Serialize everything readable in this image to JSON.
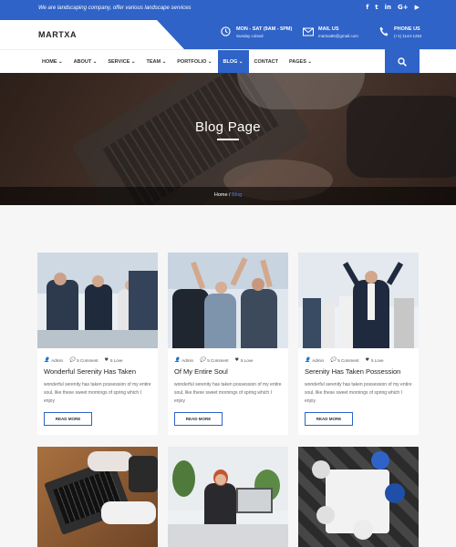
{
  "topbar": {
    "tagline": "We are landscaping company, offer various landscape services",
    "social": [
      {
        "icon": "facebook-icon",
        "glyph": "f"
      },
      {
        "icon": "twitter-icon",
        "glyph": "t"
      },
      {
        "icon": "linkedin-icon",
        "glyph": "in"
      },
      {
        "icon": "google-plus-icon",
        "glyph": "G+"
      },
      {
        "icon": "youtube-icon",
        "glyph": "▶"
      }
    ]
  },
  "header": {
    "logo": "MARTXA",
    "hours": {
      "title": "MON - SAT (9AM - 5PM)",
      "sub": "Sunday colsed"
    },
    "mail": {
      "title": "MAIL US",
      "sub": "martxa85@gmail.com"
    },
    "phone": {
      "title": "PHONE US",
      "sub": "(+1) 1144-1254"
    }
  },
  "nav": {
    "items": [
      {
        "label": "HOME",
        "caret": true
      },
      {
        "label": "ABOUT",
        "caret": true
      },
      {
        "label": "SERVICE",
        "caret": true
      },
      {
        "label": "TEAM",
        "caret": true
      },
      {
        "label": "PORTFOLIO",
        "caret": true
      },
      {
        "label": "BLOG",
        "caret": true,
        "active": true
      },
      {
        "label": "CONTACT",
        "caret": false
      },
      {
        "label": "PAGES",
        "caret": true
      }
    ]
  },
  "hero": {
    "title": "Blog Page",
    "breadcrumb": {
      "home": "Home",
      "separator": " / ",
      "current": "Blog"
    }
  },
  "posts": [
    {
      "author": "Admin",
      "comments": "5 Comment",
      "likes": "5 Love",
      "title": "Wonderful Serenity Has Taken",
      "excerpt": "wonderful serenity has taken possession of my entire soul, like these sweet mornings of spring which I enjoy",
      "button": "READ MORE"
    },
    {
      "author": "Admin",
      "comments": "5 Comment",
      "likes": "5 Love",
      "title": "Of My Entire Soul",
      "excerpt": "wonderful serenity has taken possession of my entire soul, like these sweet mornings of spring which I enjoy",
      "button": "READ MORE"
    },
    {
      "author": "Admin",
      "comments": "5 Comment",
      "likes": "5 Love",
      "title": "Serenity Has Taken Possession",
      "excerpt": "wonderful serenity has taken possession of my entire soul, like these sweet mornings of spring which I enjoy",
      "button": "READ MORE"
    }
  ],
  "colors": {
    "accent": "#2f63c8",
    "background": "#f6f6f6"
  }
}
